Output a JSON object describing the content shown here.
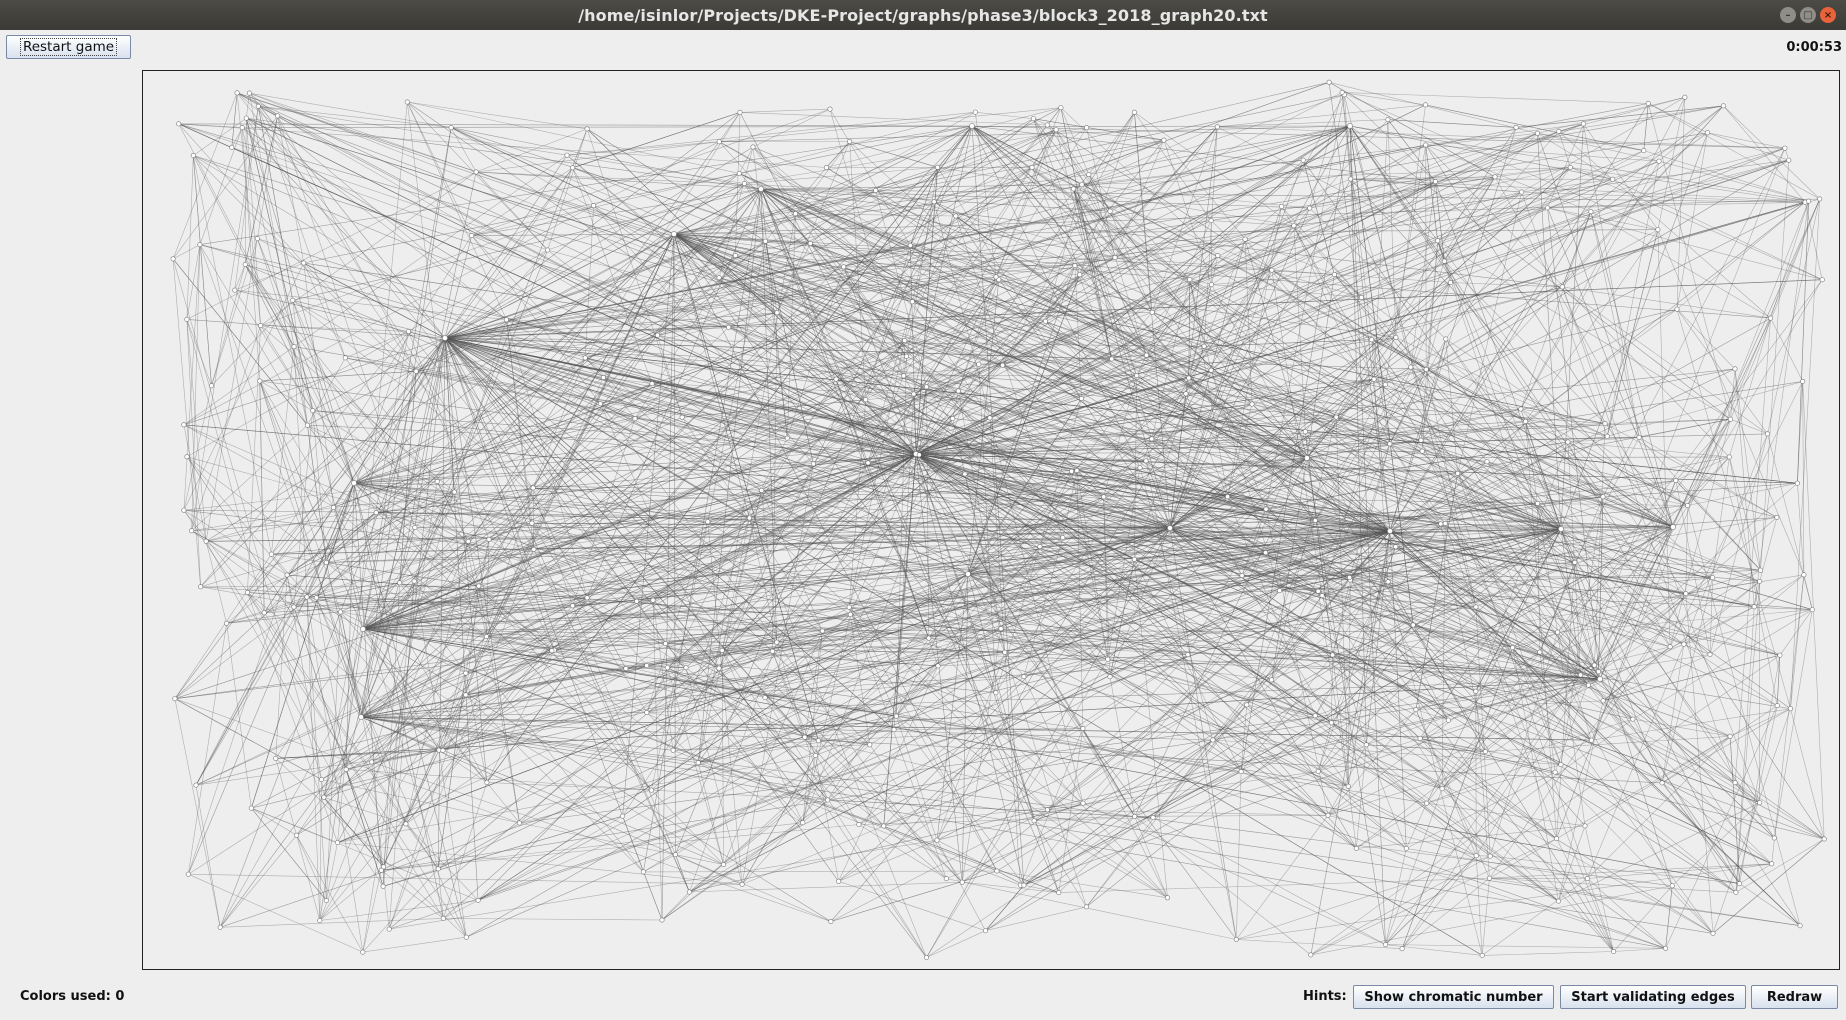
{
  "window": {
    "title": "/home/isinlor/Projects/DKE-Project/graphs/phase3/block3_2018_graph20.txt",
    "controls": [
      "minimize-icon",
      "maximize-icon",
      "close-icon"
    ]
  },
  "toolbar": {
    "restart_label": "Restart game",
    "timer": "0:00:53"
  },
  "footer": {
    "colors_used": "Colors used: 0",
    "hints_label": "Hints:",
    "show_chromatic_label": "Show chromatic number",
    "start_validating_label": "Start validating edges",
    "redraw_label": "Redraw"
  },
  "colors": {
    "edge": "#555555",
    "node_fill": "#ffffff",
    "node_stroke": "#777777",
    "background": "#eeeeee"
  }
}
